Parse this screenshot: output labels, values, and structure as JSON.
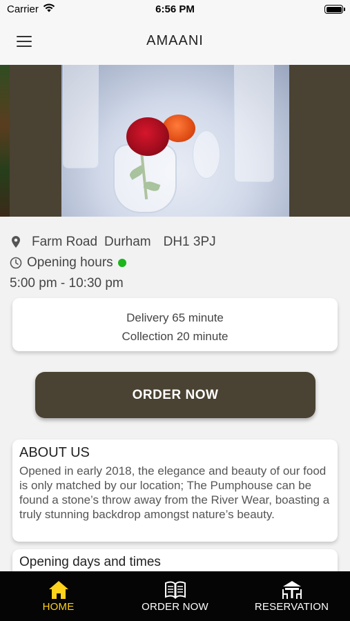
{
  "status_bar": {
    "carrier": "Carrier",
    "time": "6:56 PM"
  },
  "nav": {
    "title": "AMAANI"
  },
  "location": {
    "street": "Farm Road",
    "city": "Durham",
    "postcode": "DH1 3PJ"
  },
  "opening": {
    "label": "Opening hours",
    "status_color": "#1cb51c",
    "hours": "5:00 pm - 10:30 pm"
  },
  "delivery": {
    "delivery_text": "Delivery 65 minute",
    "collection_text": "Collection 20 minute"
  },
  "order_button": {
    "label": "ORDER NOW"
  },
  "about": {
    "title": "ABOUT US",
    "text": "Opened in early 2018, the elegance and beauty of our food is only matched by our location; The Pumphouse can be found a stone’s throw away from the River Wear, boasting a truly stunning backdrop amongst nature’s beauty."
  },
  "hours_section": {
    "title": "Opening days and times"
  },
  "tabs": [
    {
      "label": "HOME",
      "icon": "home-icon",
      "active": true
    },
    {
      "label": "ORDER NOW",
      "icon": "menu-book-icon",
      "active": false
    },
    {
      "label": "RESERVATION",
      "icon": "table-icon",
      "active": false
    }
  ],
  "colors": {
    "brand": "#4a4232",
    "active_tab": "#ffd21c",
    "tab_bar": "#050505"
  }
}
